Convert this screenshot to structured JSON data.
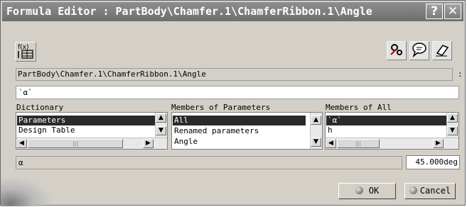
{
  "window": {
    "title": "Formula Editor : PartBody\\Chamfer.1\\ChamferRibbon.1\\Angle",
    "help_label": "?",
    "close_label": "✕"
  },
  "toolbar": {
    "formula_icon": "formula-table-icon",
    "tools": [
      {
        "icon": "gear-wizard-icon",
        "glyph": "⚙"
      },
      {
        "icon": "comment-icon",
        "glyph": "💬"
      },
      {
        "icon": "eraser-icon",
        "glyph": "⌫"
      }
    ]
  },
  "parameter_path": "PartBody\\Chamfer.1\\ChamferRibbon.1\\Angle",
  "path_suffix": ":",
  "formula_value": "`α`",
  "dictionary": {
    "label": "Dictionary",
    "items": [
      "Parameters",
      "Design Table"
    ],
    "selected": 0
  },
  "members_of_parameters": {
    "label": "Members of Parameters",
    "items": [
      "All",
      "Renamed parameters",
      "Angle"
    ],
    "selected": 0
  },
  "members_of_all": {
    "label": "Members of All",
    "items": [
      "`α`",
      "h"
    ],
    "selected": 0
  },
  "status": {
    "text": "α",
    "value": "45.000deg"
  },
  "buttons": {
    "ok": "OK",
    "cancel": "Cancel"
  },
  "scroll": {
    "up": "▲",
    "down": "▼",
    "left": "◀",
    "right": "▶",
    "thumb_grip": "|||"
  }
}
